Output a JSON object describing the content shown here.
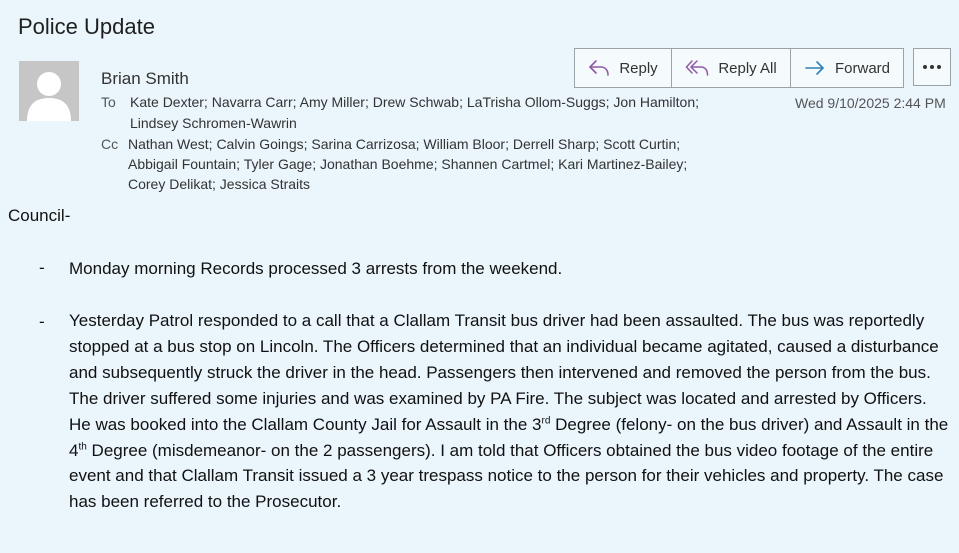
{
  "email": {
    "subject": "Police Update",
    "sender": "Brian Smith",
    "to_label": "To",
    "to_line1": "Kate Dexter; Navarra  Carr; Amy Miller; Drew Schwab; LaTrisha Ollom-Suggs; Jon Hamilton;",
    "to_line2": "Lindsey Schromen-Wawrin",
    "cc_label": "Cc",
    "cc_line1": "Nathan West; Calvin Goings; Sarina Carrizosa; William Bloor; Derrell Sharp; Scott Curtin;",
    "cc_line2": "Abbigail Fountain; Tyler Gage; Jonathan Boehme; Shannen Cartmel; Kari Martinez-Bailey;",
    "cc_line3": "Corey Delikat; Jessica Straits",
    "date": "Wed 9/10/2025 2:44 PM"
  },
  "actions": {
    "reply": "Reply",
    "reply_all": "Reply All",
    "forward": "Forward",
    "more_icon": "more-icon"
  },
  "icons": {
    "reply": "reply-arrow-icon",
    "reply_all": "reply-all-arrow-icon",
    "forward": "forward-arrow-icon",
    "avatar": "person-avatar-icon"
  },
  "colors": {
    "background": "#eaf5fc",
    "reply_icon": "#8e5aa8",
    "forward_icon": "#2f7fb8"
  },
  "body": {
    "greeting": "Council-",
    "bullet_marker": "-",
    "item1": "Monday morning Records processed 3 arrests from the weekend.",
    "item2_part1": "Yesterday Patrol responded to a call that a Clallam Transit bus driver had been assaulted. The bus was reportedly stopped at a bus stop on Lincoln.  The Officers determined that an individual became agitated, caused a disturbance and  subsequently struck the driver in the head.   Passengers  then intervened and removed the person from the bus.   The driver suffered some injuries and was examined by PA Fire.  The subject was located and arrested by Officers.  He was  booked into the Clallam County Jail for Assault in the 3",
    "item2_sup1": "rd",
    "item2_part2": " Degree (felony- on the bus driver) and Assault in the 4",
    "item2_sup2": "th",
    "item2_part3": " Degree (misdemeanor- on the 2 passengers).  I am told that Officers obtained the bus video footage of the entire event and that Clallam Transit issued a 3 year trespass notice to the person for their vehicles and property.   The case has been referred to the Prosecutor."
  }
}
